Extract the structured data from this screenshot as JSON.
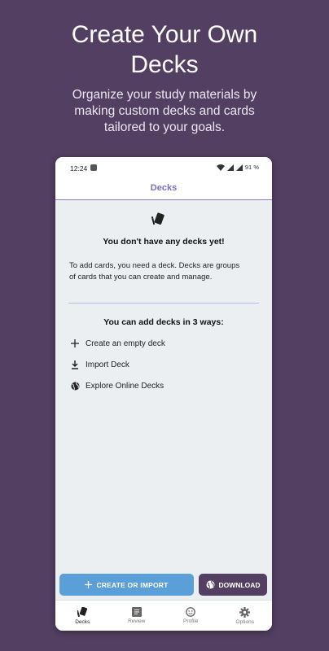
{
  "hero": {
    "title_line1": "Create Your Own",
    "title_line2": "Decks",
    "subtitle_line1": "Organize your study materials by",
    "subtitle_line2": "making custom decks and cards",
    "subtitle_line3": "tailored to your goals."
  },
  "status_bar": {
    "time": "12:24",
    "battery": "91 %"
  },
  "app_bar": {
    "title": "Decks"
  },
  "empty_state": {
    "title": "You don't have any decks yet!",
    "text_line1": "To add cards, you need a deck. Decks are groups",
    "text_line2": "of cards that you can create and manage."
  },
  "ways": {
    "title": "You can add decks in 3 ways:",
    "items": [
      {
        "label": "Create an empty deck",
        "icon": "plus-icon"
      },
      {
        "label": "Import Deck",
        "icon": "download-icon"
      },
      {
        "label": "Explore Online Decks",
        "icon": "globe-icon"
      }
    ]
  },
  "actions": {
    "create_label": "CREATE OR IMPORT",
    "download_label": "DOWNLOAD"
  },
  "nav": {
    "items": [
      {
        "label": "Decks",
        "icon": "decks-icon",
        "active": true
      },
      {
        "label": "Review",
        "icon": "review-icon",
        "active": false
      },
      {
        "label": "Profile",
        "icon": "profile-icon",
        "active": false
      },
      {
        "label": "Options",
        "icon": "gear-icon",
        "active": false
      }
    ]
  },
  "colors": {
    "background": "#523f61",
    "accent": "#7d6dc4",
    "create_button": "#5a9fd8",
    "download_button": "#523f61"
  }
}
